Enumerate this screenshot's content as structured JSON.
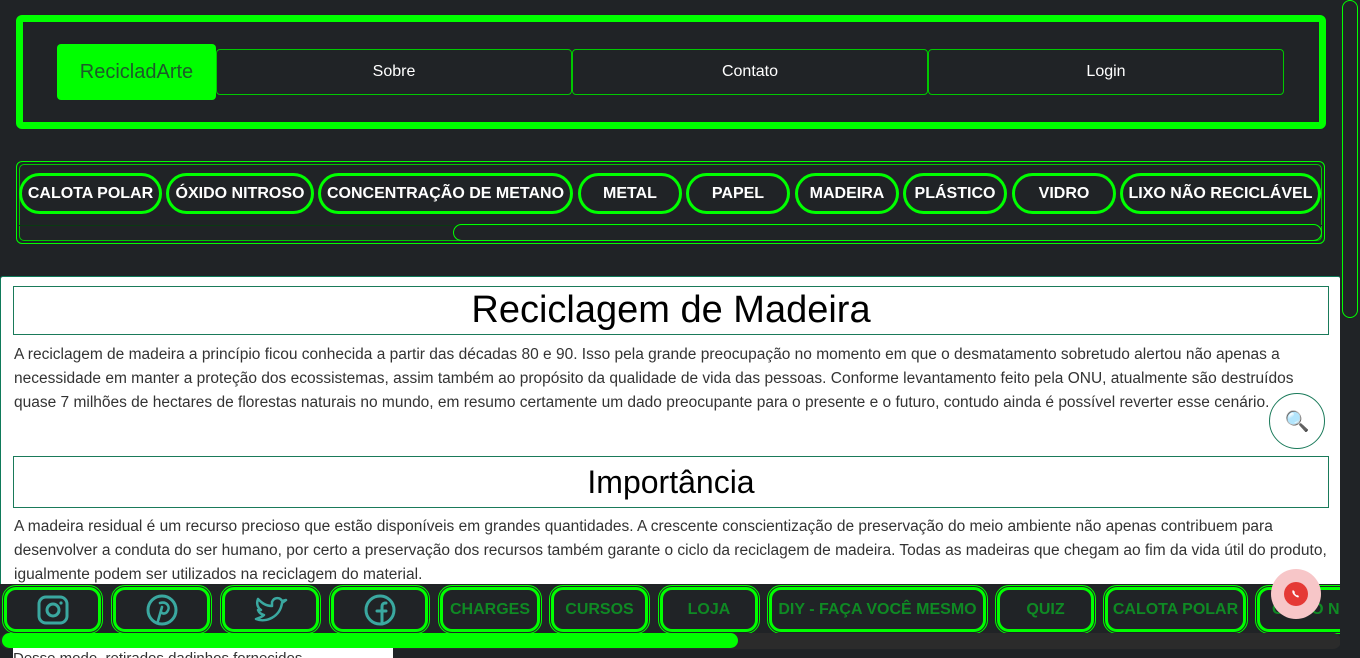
{
  "header": {
    "brand": "RecicladArte",
    "nav": [
      "Sobre",
      "Contato",
      "Login"
    ]
  },
  "topics": [
    "CALOTA POLAR",
    "ÓXIDO NITROSO",
    "CONCENTRAÇÃO DE METANO",
    "METAL",
    "PAPEL",
    "MADEIRA",
    "PLÁSTICO",
    "VIDRO",
    "LIXO NÃO RECICLÁVEL"
  ],
  "article": {
    "title": "Reciclagem de Madeira",
    "intro": "A reciclagem de madeira a princípio ficou conhecida a partir das décadas 80 e 90. Isso pela grande preocupação no momento em que o desmatamento sobretudo alertou não apenas a necessidade em manter a proteção dos ecossistemas, assim também ao propósito da qualidade de vida das pessoas. Conforme levantamento feito pela ONU, atualmente são destruídos quase 7 milhões de hectares de florestas naturais no mundo, em resumo certamente um dado preocupante para o presente e o futuro, contudo ainda é possível reverter esse cenário.",
    "section_title": "Importância",
    "section_text": "A madeira residual é um recurso precioso que estão disponíveis em grandes quantidades. A crescente conscientização de preservação do meio ambiente não apenas contribuem para desenvolver a conduta do ser humano, por certo a preservação dos recursos também garante o ciclo da reciclagem de madeira. Todas as madeiras que chegam ao fim da vida útil do produto, igualmente podem ser utilizados na reciclagem do material.",
    "cut_text": "Desse modo, retirados dadinhos fornecidos..."
  },
  "bottom": {
    "social": [
      "instagram-icon",
      "pinterest-icon",
      "twitter-icon",
      "facebook-icon"
    ],
    "links": [
      "CHARGES",
      "CURSOS",
      "LOJA",
      "DIY - FAÇA VOCÊ MESMO",
      "QUIZ",
      "CALOTA POLAR",
      "ÓXIDO NI"
    ]
  },
  "colors": {
    "accent": "#00ff00",
    "background": "#202326"
  }
}
